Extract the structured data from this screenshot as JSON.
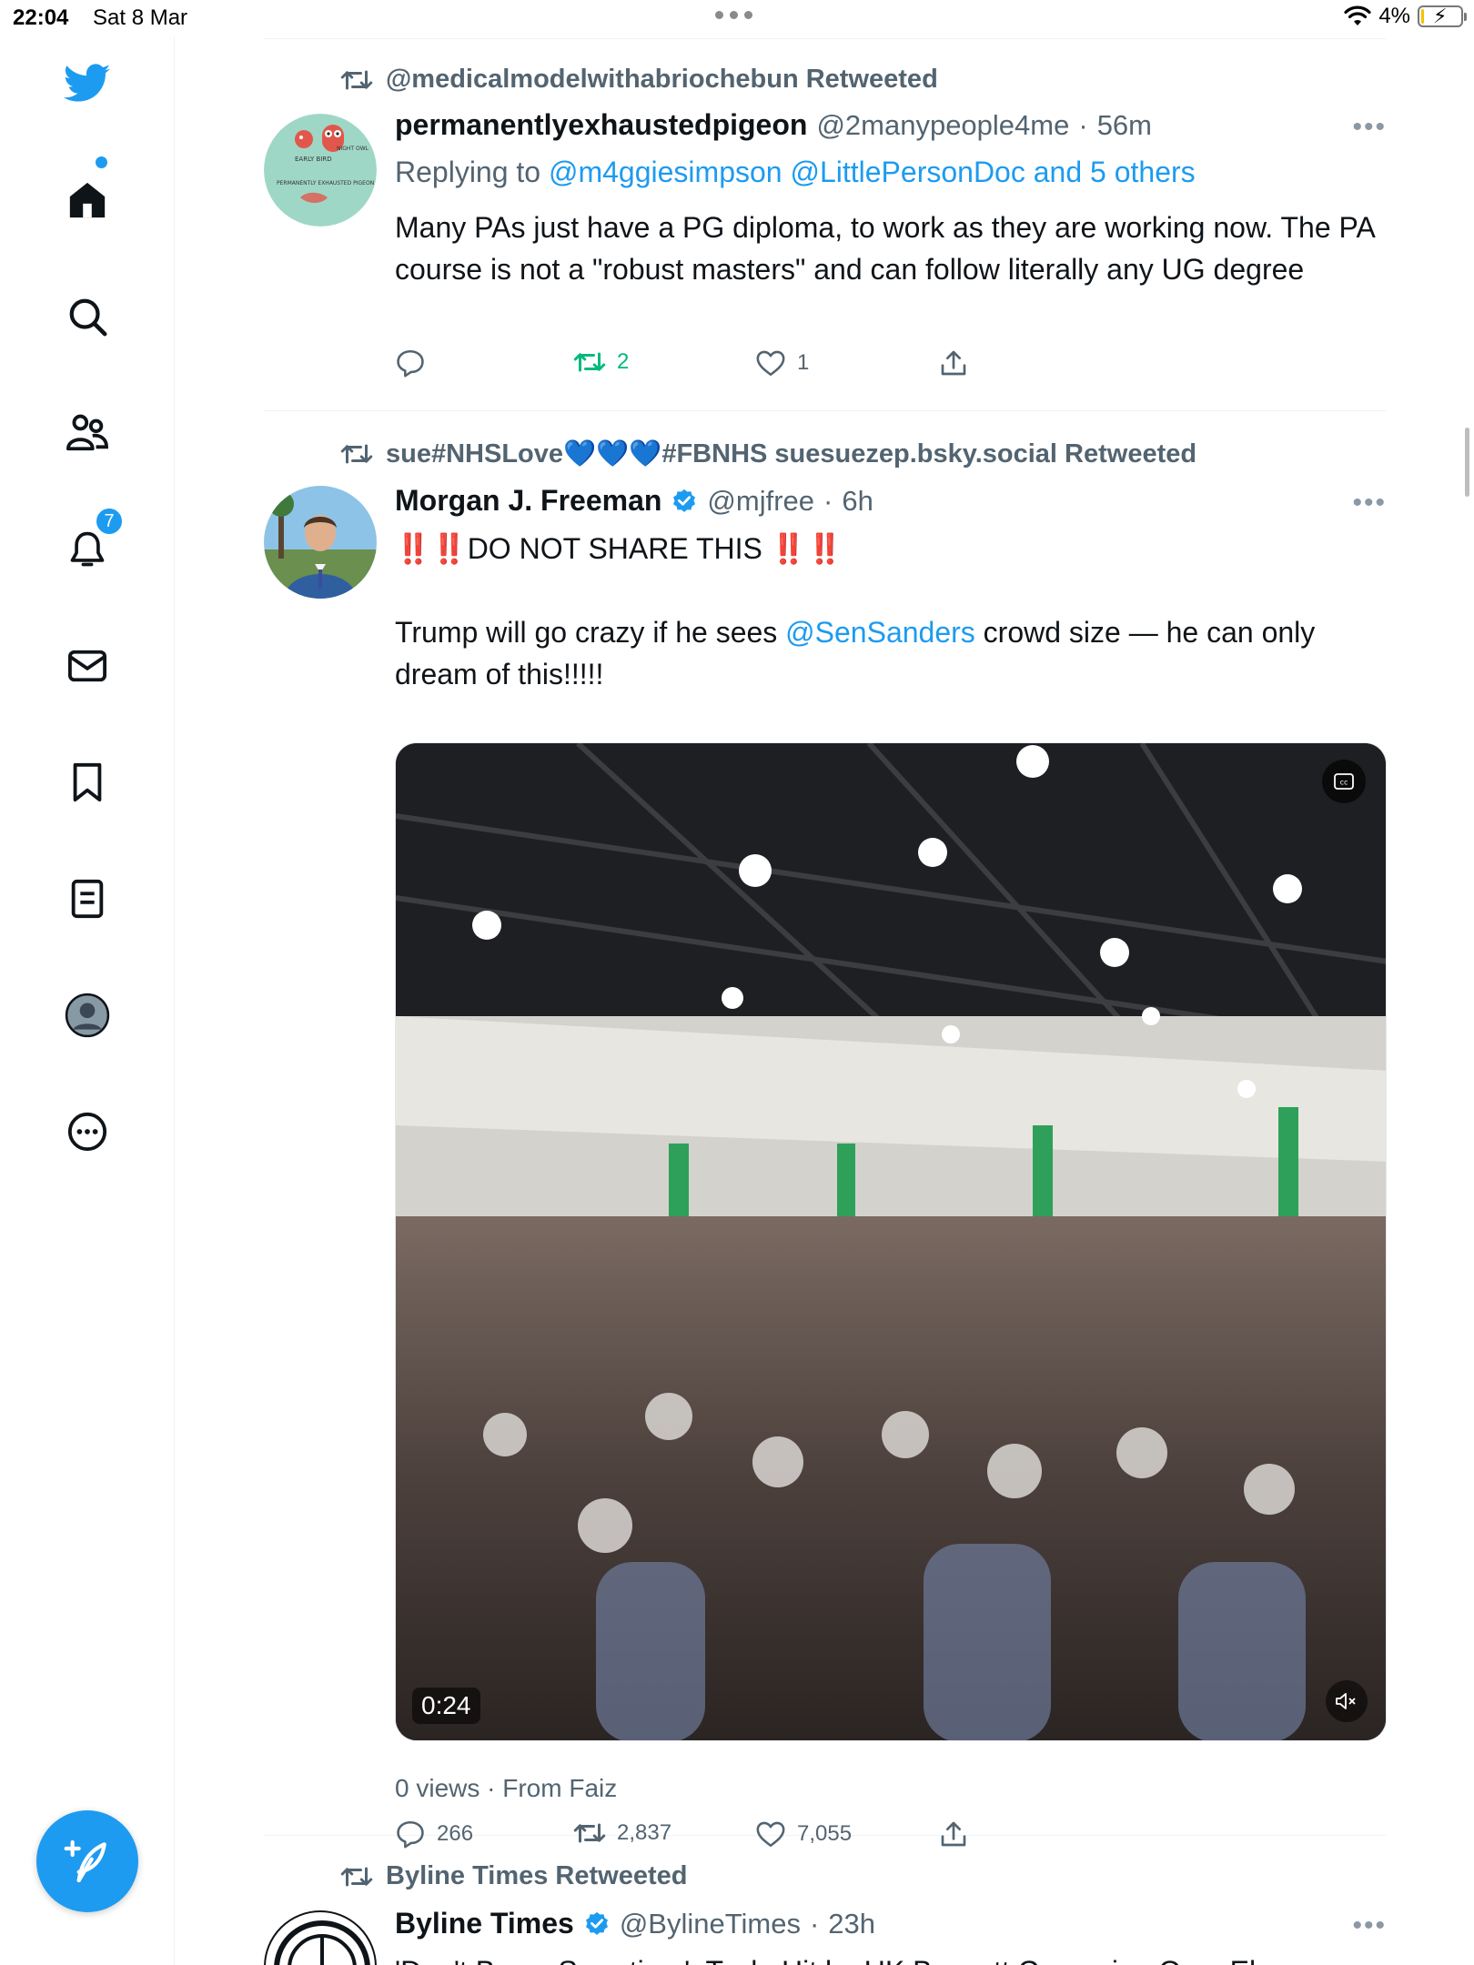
{
  "status_bar": {
    "time": "22:04",
    "date": "Sat 8 Mar",
    "battery": "4%",
    "battery_level": 0.04
  },
  "sidebar": {
    "items": [
      {
        "icon": "twitter-bird-icon"
      },
      {
        "icon": "home-icon"
      },
      {
        "icon": "search-icon"
      },
      {
        "icon": "communities-icon"
      },
      {
        "icon": "notifications-icon",
        "badge": "7"
      },
      {
        "icon": "messages-icon"
      },
      {
        "icon": "bookmarks-icon"
      },
      {
        "icon": "lists-icon"
      },
      {
        "icon": "profile-icon"
      },
      {
        "icon": "more-icon"
      }
    ],
    "compose_icon": "compose-tweet-icon",
    "accent": "#1d9bf0"
  },
  "tweets": [
    {
      "retweeted_by": "@medicalmodelwithabriochebun Retweeted",
      "name": "permanentlyexhaustedpigeon",
      "handle": "@2manypeople4me",
      "dot": "·",
      "time": "56m",
      "more": "•••",
      "replying_to_prefix": "Replying to",
      "replying_to_users": "@m4ggiesimpson @LittlePersonDoc and 5 others",
      "avatar_text": {
        "early_bird": "EARLY BIRD",
        "night_owl": "NIGHT OWL",
        "bottom": "PERMANENTLY EXHAUSTED PIGEON"
      },
      "text": "Many PAs just have a PG diploma, to work as they are working now. The PA course is not a \"robust masters\" and can follow literally any UG degree",
      "replies": "",
      "retweets": "2",
      "likes": "1"
    },
    {
      "retweeted_by": "sue#NHSLove💙💙💙#FBNHS suesuezep.bsky.social Retweeted",
      "name": "Morgan J. Freeman",
      "verified": true,
      "handle": "@mjfree",
      "dot": "·",
      "time": "6h",
      "more": "•••",
      "text_line1": "‼️‼️DO NOT SHARE THIS ‼️‼️",
      "text_line2_before": "Trump will go crazy if he sees ",
      "text_line2_mention": "@SenSanders",
      "text_line2_after": " crowd size — he can only dream of this!!!!!",
      "video": {
        "duration": "0:24",
        "cc_icon": "closed-captions-icon",
        "mute_icon": "muted-speaker-icon"
      },
      "views": "0 views · From Faiz",
      "replies": "266",
      "retweets": "2,837",
      "likes": "7,055"
    },
    {
      "retweeted_by": "Byline Times Retweeted",
      "name": "Byline Times",
      "verified": true,
      "handle": "@BylineTimes",
      "dot": "·",
      "time": "23h",
      "more": "•••",
      "text_partial": "'Don't Buy a Swasticar': Tesla Hit by UK Boycott Campaign Over Elon"
    }
  ]
}
